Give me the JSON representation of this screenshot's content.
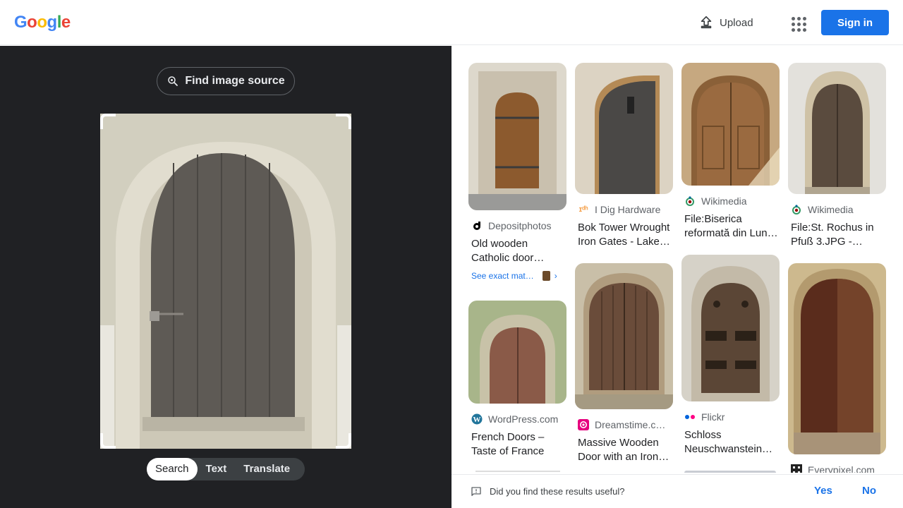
{
  "header": {
    "logo_letters": [
      "G",
      "o",
      "o",
      "g",
      "l",
      "e"
    ],
    "upload_label": "Upload",
    "signin_label": "Sign in"
  },
  "left": {
    "find_source_label": "Find image source",
    "modes": [
      "Search",
      "Text",
      "Translate"
    ],
    "active_mode": "Search"
  },
  "results": [
    {
      "source": "Depositphotos",
      "title_1": "Old wooden",
      "title_2": "Catholic door…",
      "exact": "See exact mat…"
    },
    {
      "source": "I Dig Hardware",
      "title_1": "Bok Tower Wrought",
      "title_2": "Iron Gates - Lake…"
    },
    {
      "source": "Wikimedia",
      "title_1": "File:Biserica",
      "title_2": "reformată din Lun…"
    },
    {
      "source": "Wikimedia",
      "title_1": "File:St. Rochus in",
      "title_2": "Pfuß 3.JPG -…"
    },
    {
      "source": "WordPress.com",
      "title_1": "French Doors –",
      "title_2": "Taste of France"
    },
    {
      "source": "Dreamstime.c…",
      "title_1": "Massive Wooden",
      "title_2": "Door with an Iron…"
    },
    {
      "source": "Flickr",
      "title_1": "Schloss",
      "title_2": "Neuschwanstein…"
    },
    {
      "source": "Everypixel.com"
    }
  ],
  "feedback": {
    "question": "Did you find these results useful?",
    "yes": "Yes",
    "no": "No"
  },
  "colors": {
    "accent": "#1a73e8",
    "dark_panel": "#202124"
  }
}
